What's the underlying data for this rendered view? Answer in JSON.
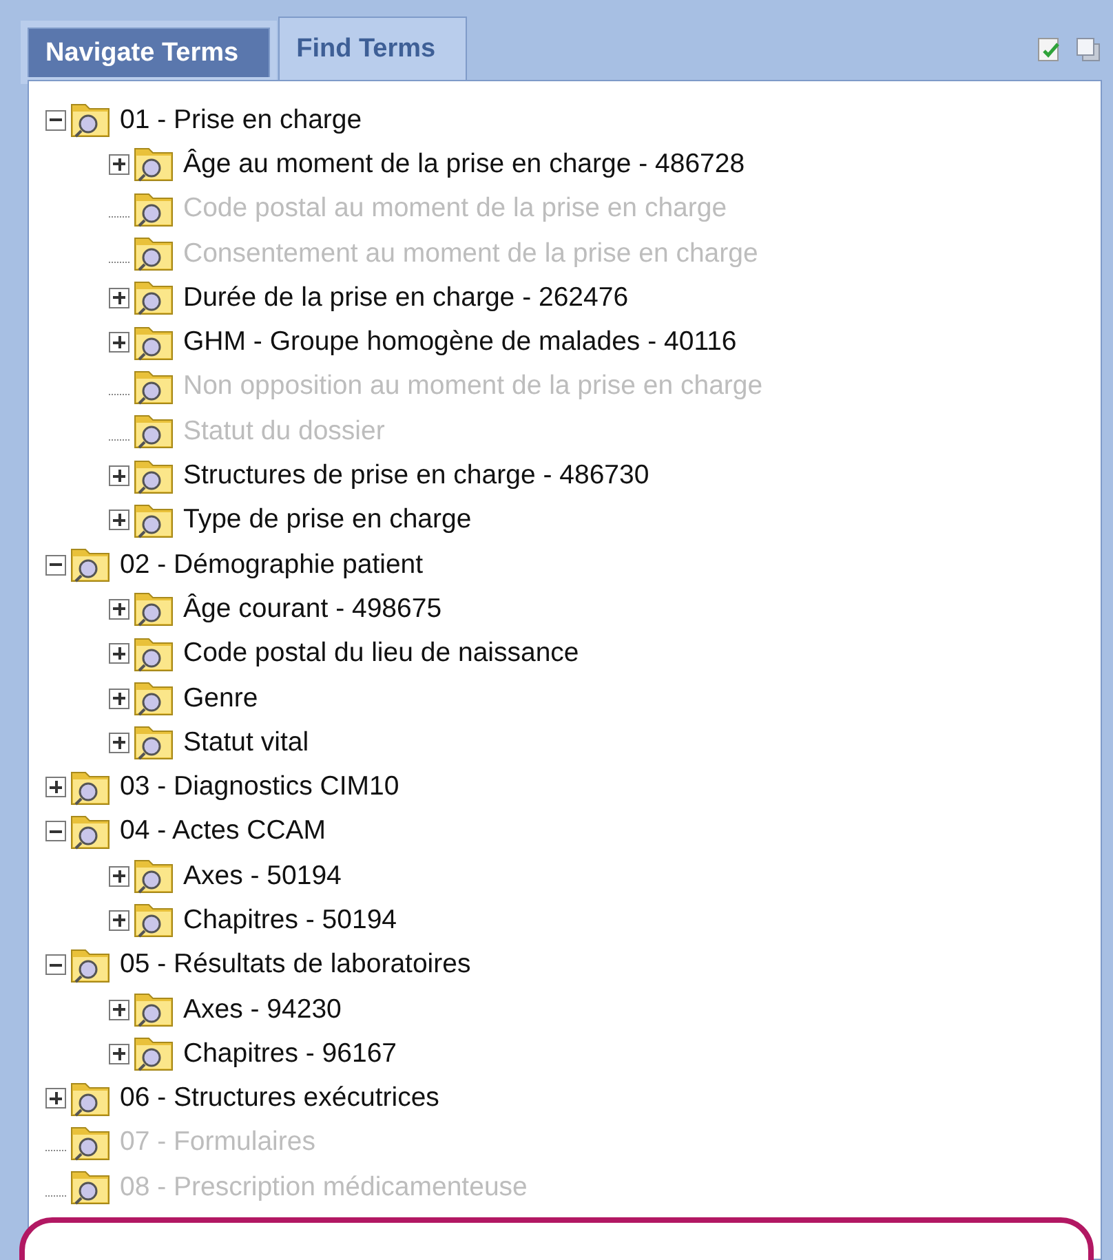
{
  "tabs": [
    {
      "label": "Navigate Terms",
      "selected": true
    },
    {
      "label": "Find Terms",
      "selected": false
    }
  ],
  "tree": [
    {
      "label": "01 - Prise en charge",
      "expandable": true,
      "expanded": true,
      "disabled": false,
      "children": [
        {
          "label": "Âge au moment de la prise en charge - 486728",
          "expandable": true,
          "expanded": false,
          "disabled": false
        },
        {
          "label": "Code postal au moment de la prise en charge",
          "expandable": false,
          "expanded": false,
          "disabled": true
        },
        {
          "label": "Consentement au moment de la prise en charge",
          "expandable": false,
          "expanded": false,
          "disabled": true
        },
        {
          "label": "Durée de la prise en charge - 262476",
          "expandable": true,
          "expanded": false,
          "disabled": false
        },
        {
          "label": "GHM - Groupe homogène de malades - 40116",
          "expandable": true,
          "expanded": false,
          "disabled": false
        },
        {
          "label": "Non opposition au moment de la prise en charge",
          "expandable": false,
          "expanded": false,
          "disabled": true
        },
        {
          "label": "Statut du dossier",
          "expandable": false,
          "expanded": false,
          "disabled": true
        },
        {
          "label": "Structures de prise en charge - 486730",
          "expandable": true,
          "expanded": false,
          "disabled": false
        },
        {
          "label": "Type de prise en charge",
          "expandable": true,
          "expanded": false,
          "disabled": false
        }
      ]
    },
    {
      "label": "02 - Démographie patient",
      "expandable": true,
      "expanded": true,
      "disabled": false,
      "children": [
        {
          "label": "Âge courant - 498675",
          "expandable": true,
          "expanded": false,
          "disabled": false
        },
        {
          "label": "Code postal du lieu de naissance",
          "expandable": true,
          "expanded": false,
          "disabled": false
        },
        {
          "label": "Genre",
          "expandable": true,
          "expanded": false,
          "disabled": false
        },
        {
          "label": "Statut vital",
          "expandable": true,
          "expanded": false,
          "disabled": false
        }
      ]
    },
    {
      "label": "03 - Diagnostics CIM10",
      "expandable": true,
      "expanded": false,
      "disabled": false
    },
    {
      "label": "04 - Actes CCAM",
      "expandable": true,
      "expanded": true,
      "disabled": false,
      "children": [
        {
          "label": "Axes - 50194",
          "expandable": true,
          "expanded": false,
          "disabled": false
        },
        {
          "label": "Chapitres - 50194",
          "expandable": true,
          "expanded": false,
          "disabled": false
        }
      ]
    },
    {
      "label": "05 - Résultats de laboratoires",
      "expandable": true,
      "expanded": true,
      "disabled": false,
      "children": [
        {
          "label": "Axes - 94230",
          "expandable": true,
          "expanded": false,
          "disabled": false
        },
        {
          "label": "Chapitres - 96167",
          "expandable": true,
          "expanded": false,
          "disabled": false
        }
      ]
    },
    {
      "label": "06 - Structures exécutrices",
      "expandable": true,
      "expanded": false,
      "disabled": false
    },
    {
      "label": "07 - Formulaires",
      "expandable": false,
      "expanded": false,
      "disabled": true
    },
    {
      "label": "08 - Prescription médicamenteuse",
      "expandable": false,
      "expanded": false,
      "disabled": true
    }
  ]
}
